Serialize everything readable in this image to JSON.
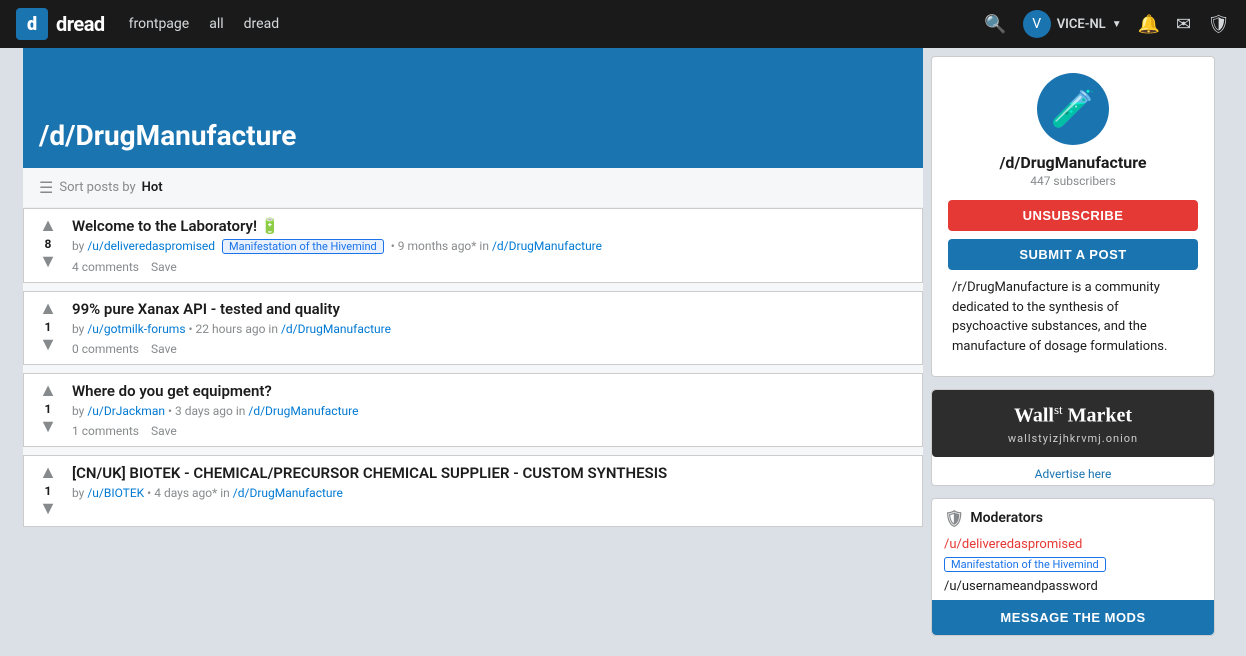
{
  "navbar": {
    "logo_letter": "d",
    "logo_text": "dread",
    "links": [
      "frontpage",
      "all",
      "dread"
    ],
    "user_name": "VICE-NL",
    "user_avatar_letter": "V"
  },
  "community": {
    "title": "/d/DrugManufacture",
    "name": "/d/DrugManufacture",
    "subscribers": "447 subscribers",
    "description": "/r/DrugManufacture is a community dedicated to the synthesis of psychoactive substances, and the manufacture of dosage formulations.",
    "avatar_icon": "🧪"
  },
  "sort_bar": {
    "label": "Sort posts by",
    "sort": "Hot"
  },
  "posts": [
    {
      "id": 1,
      "votes": 8,
      "title": "Welcome to the Laboratory! 🔋",
      "has_badge": false,
      "author": "/u/deliveredaspromised",
      "tag": "Manifestation of the Hivemind",
      "time": "9 months ago*",
      "subreddit": "/d/DrugManufacture",
      "comments": "4 comments",
      "save": "Save"
    },
    {
      "id": 2,
      "votes": 1,
      "title": "99% pure Xanax API - tested and quality",
      "has_badge": false,
      "author": "/u/gotmilk-forums",
      "tag": "",
      "time": "22 hours ago",
      "subreddit": "/d/DrugManufacture",
      "comments": "0 comments",
      "save": "Save"
    },
    {
      "id": 3,
      "votes": 1,
      "title": "Where do you get equipment?",
      "has_badge": false,
      "author": "/u/DrJackman",
      "tag": "",
      "time": "3 days ago",
      "subreddit": "/d/DrugManufacture",
      "comments": "1 comments",
      "save": "Save"
    },
    {
      "id": 4,
      "votes": 1,
      "title": "[CN/UK] BIOTEK - CHEMICAL/PRECURSOR CHEMICAL SUPPLIER - CUSTOM SYNTHESIS",
      "has_badge": false,
      "author": "/u/BIOTEK",
      "tag": "",
      "time": "4 days ago*",
      "subreddit": "/d/DrugManufacture",
      "comments": "",
      "save": ""
    }
  ],
  "buttons": {
    "unsubscribe": "UNSUBSCRIBE",
    "submit_post": "SUBMIT A POST",
    "message_mods": "MESSAGE THE MODS"
  },
  "ad": {
    "title_main": "Wall",
    "title_st": "st",
    "title_market": " Market",
    "subtitle": "wallstyizjhkrvmj.onion",
    "link": "Advertise here"
  },
  "moderators": {
    "label": "Moderators",
    "mods": [
      {
        "name": "/u/deliveredaspromised",
        "tag": "Manifestation of the Hivemind"
      },
      {
        "name": "/u/usernameandpassword",
        "tag": ""
      }
    ]
  }
}
